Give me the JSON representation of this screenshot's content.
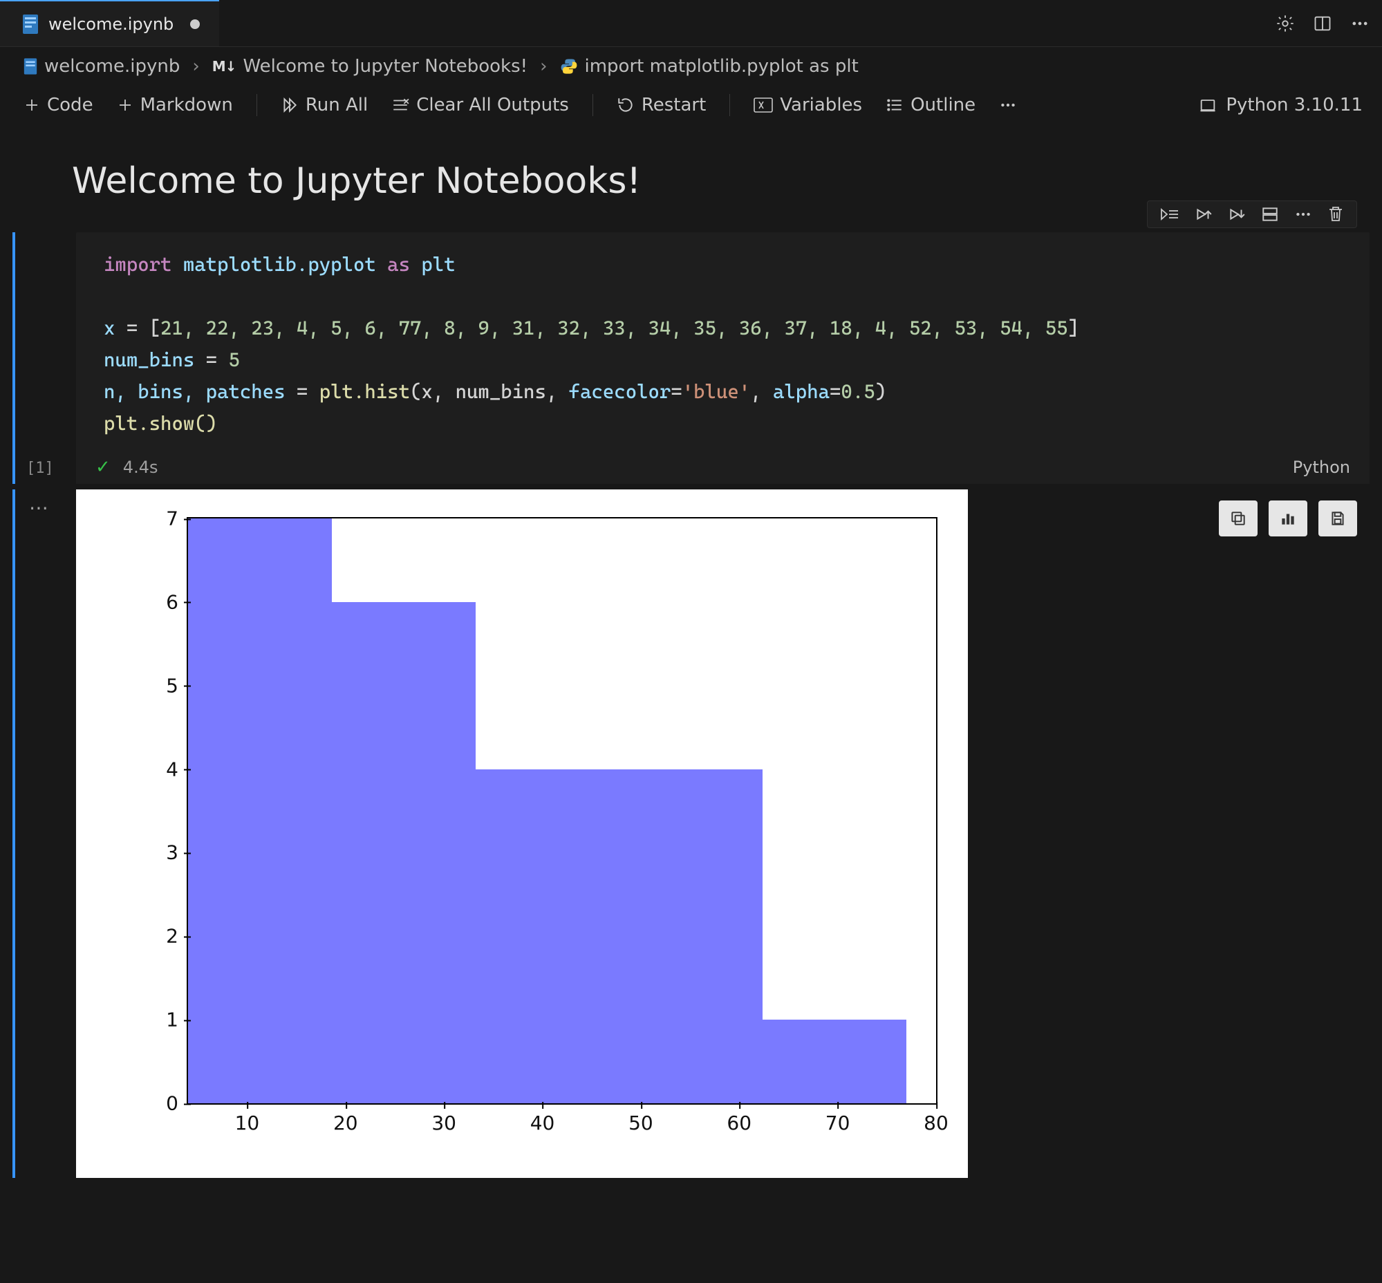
{
  "tab": {
    "filename": "welcome.ipynb",
    "dirty": true
  },
  "breadcrumb": {
    "file": "welcome.ipynb",
    "section": "Welcome to Jupyter Notebooks!",
    "cell_hint": "import matplotlib.pyplot as plt"
  },
  "toolbar": {
    "add_code": "Code",
    "add_markdown": "Markdown",
    "run_all": "Run All",
    "clear_outputs": "Clear All Outputs",
    "restart": "Restart",
    "variables": "Variables",
    "outline": "Outline"
  },
  "kernel": {
    "label": "Python 3.10.11"
  },
  "title": "Welcome to Jupyter Notebooks!",
  "cell": {
    "exec_count": "[1]",
    "duration": "4.4s",
    "language": "Python",
    "code": {
      "import_kw": "import",
      "import_mod": "matplotlib.pyplot",
      "as_kw": "as",
      "alias": "plt",
      "x_name": "x",
      "eq": "=",
      "list_open": "[",
      "list_vals": "21, 22, 23, 4, 5, 6, 77, 8, 9, 31, 32, 33, 34, 35, 36, 37, 18, 4, 52, 53, 54, 55",
      "list_close": "]",
      "nb_name": "num_bins",
      "nb_val": "5",
      "lhs": "n, bins, patches",
      "hist_call_a": "plt.hist",
      "hist_args": "(x, num_bins, ",
      "facecolor_k": "facecolor",
      "facecolor_eq": "=",
      "facecolor_v": "'blue'",
      "sep": ", ",
      "alpha_k": "alpha",
      "alpha_eq": "=",
      "alpha_v": "0.5",
      "close_paren": ")",
      "show_call": "plt.show()"
    }
  },
  "chart_data": {
    "type": "bar",
    "title": "",
    "xlabel": "",
    "ylabel": "",
    "xlim": [
      4,
      80
    ],
    "ylim": [
      0,
      7
    ],
    "bin_edges": [
      4,
      18.6,
      33.2,
      47.8,
      62.4,
      77
    ],
    "values": [
      7,
      6,
      4,
      4,
      1
    ],
    "xticks": [
      10,
      20,
      30,
      40,
      50,
      60,
      70,
      80
    ],
    "yticks": [
      0,
      1,
      2,
      3,
      4,
      5,
      6,
      7
    ],
    "bar_color": "#7a7aff",
    "bar_alpha": 0.5
  }
}
